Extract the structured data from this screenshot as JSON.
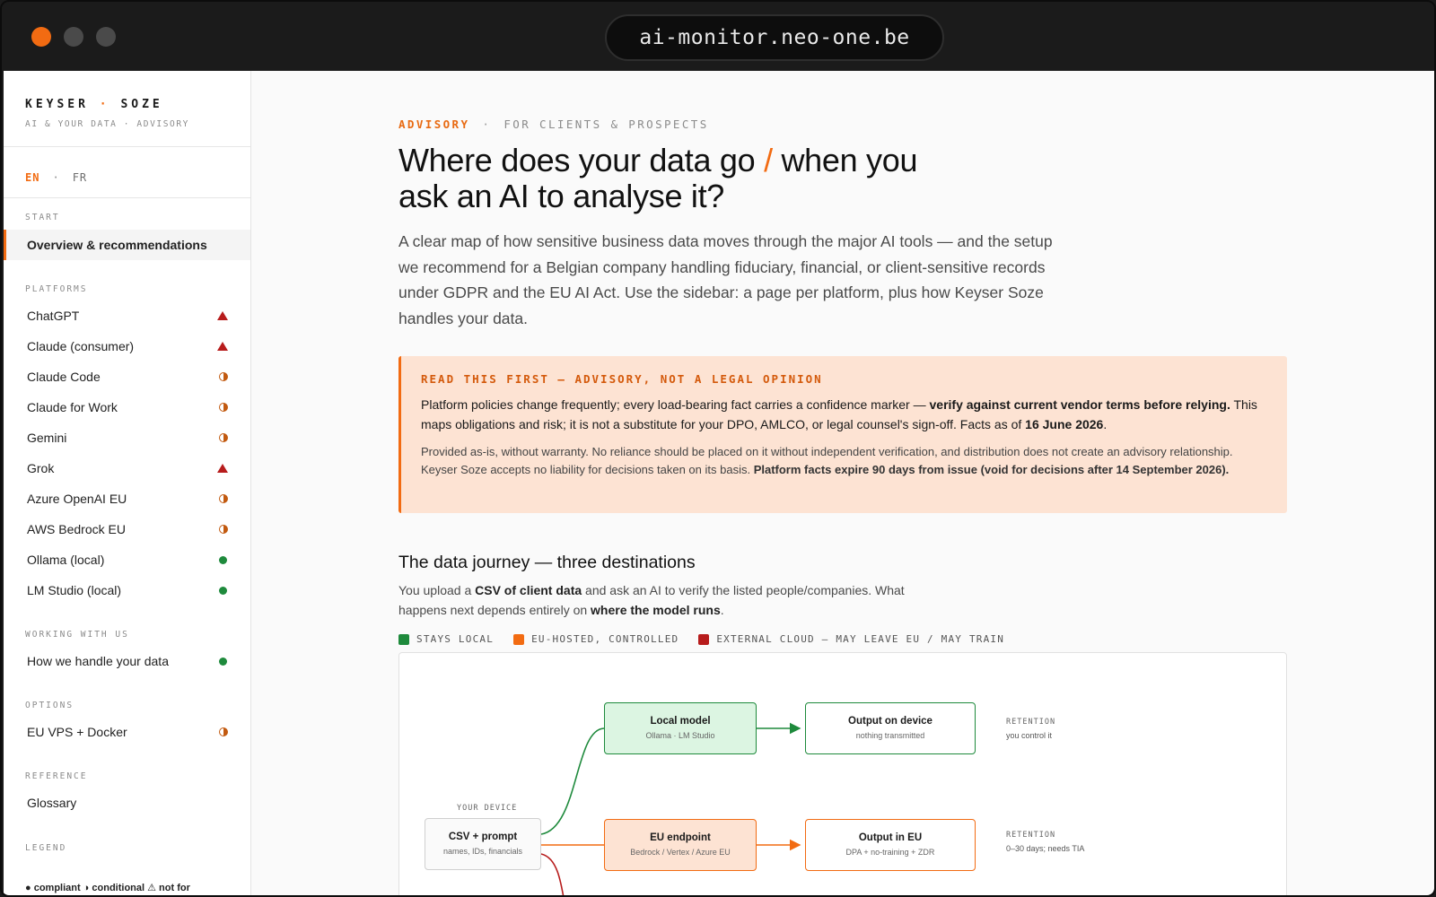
{
  "window": {
    "url": "ai-monitor.neo-one.be"
  },
  "sidebar": {
    "brand_left": "KEYSER",
    "brand_sep": "·",
    "brand_right": "SOZE",
    "brand_sub": "AI & YOUR DATA · ADVISORY",
    "lang_active": "EN",
    "lang_sep": "·",
    "lang_other": "FR",
    "sections": {
      "start": "START",
      "platforms": "PLATFORMS",
      "working": "WORKING WITH US",
      "options": "OPTIONS",
      "reference": "REFERENCE",
      "legend": "LEGEND"
    },
    "start_items": [
      {
        "label": "Overview & recommendations"
      }
    ],
    "platform_items": [
      {
        "label": "ChatGPT",
        "status": "not-for"
      },
      {
        "label": "Claude (consumer)",
        "status": "not-for"
      },
      {
        "label": "Claude Code",
        "status": "conditional"
      },
      {
        "label": "Claude for Work",
        "status": "conditional"
      },
      {
        "label": "Gemini",
        "status": "conditional"
      },
      {
        "label": "Grok",
        "status": "not-for"
      },
      {
        "label": "Azure OpenAI EU",
        "status": "conditional"
      },
      {
        "label": "AWS Bedrock EU",
        "status": "conditional"
      },
      {
        "label": "Ollama (local)",
        "status": "compliant"
      },
      {
        "label": "LM Studio (local)",
        "status": "compliant"
      }
    ],
    "working_items": [
      {
        "label": "How we handle your data",
        "status": "compliant"
      }
    ],
    "option_items": [
      {
        "label": "EU VPS + Docker",
        "status": "conditional"
      }
    ],
    "reference_items": [
      {
        "label": "Glossary"
      }
    ],
    "legend_text": "● compliant ◑ conditional ⚠ not for"
  },
  "main": {
    "eyebrow_tag": "ADVISORY",
    "eyebrow_sep": "·",
    "eyebrow_audience": "FOR CLIENTS & PROSPECTS",
    "title_part1": "Where does your data go",
    "title_slash": "/",
    "title_part2": "when you ask an AI to analyse it?",
    "lede": "A clear map of how sensitive business data moves through the major AI tools — and the setup we recommend for a Belgian company handling fiduciary, financial, or client-sensitive records under GDPR and the EU AI Act. Use the sidebar: a page per platform, plus how Keyser Soze handles your data.",
    "callout": {
      "heading": "READ THIS FIRST — ADVISORY, NOT A LEGAL OPINION",
      "body_1": "Platform policies change frequently; every load-bearing fact carries a confidence marker — ",
      "body_bold_1": "verify against current vendor terms before relying.",
      "body_2": " This maps obligations and risk; it is not a substitute for your DPO, AMLCO, or legal counsel's sign-off. Facts as of ",
      "body_bold_2": "16 June 2026",
      "body_3": ".",
      "small_1": "Provided as-is, without warranty. No reliance should be placed on it without independent verification, and distribution does not create an advisory relationship. Keyser Soze accepts no liability for decisions taken on its basis. ",
      "small_bold": "Platform facts expire 90 days from issue (void for decisions after 14 September 2026)."
    },
    "journey": {
      "heading": "The data journey — three destinations",
      "p1": "You upload a ",
      "p_bold1": "CSV of client data",
      "p2": " and ask an AI to verify the listed people/companies. What happens next depends entirely on ",
      "p_bold2": "where the model runs",
      "p3": ".",
      "legend": [
        {
          "label": "STAYS LOCAL",
          "color": "#1e8a3c"
        },
        {
          "label": "EU-HOSTED, CONTROLLED",
          "color": "#f26b12"
        },
        {
          "label": "EXTERNAL CLOUD — MAY LEAVE EU / MAY TRAIN",
          "color": "#b71c1c"
        }
      ],
      "diagram": {
        "device_label": "YOUR DEVICE",
        "source_title": "CSV + prompt",
        "source_sub": "names, IDs, financials",
        "local_title": "Local model",
        "local_sub": "Ollama · LM Studio",
        "local_out_title": "Output on device",
        "local_out_sub": "nothing transmitted",
        "local_ret_label": "RETENTION",
        "local_ret_val": "you control it",
        "eu_title": "EU endpoint",
        "eu_sub": "Bedrock / Vertex / Azure EU",
        "eu_out_title": "Output in EU",
        "eu_out_sub": "DPA + no-training + ZDR",
        "eu_ret_label": "RETENTION",
        "eu_ret_val": "0–30 days; needs TIA"
      }
    }
  }
}
